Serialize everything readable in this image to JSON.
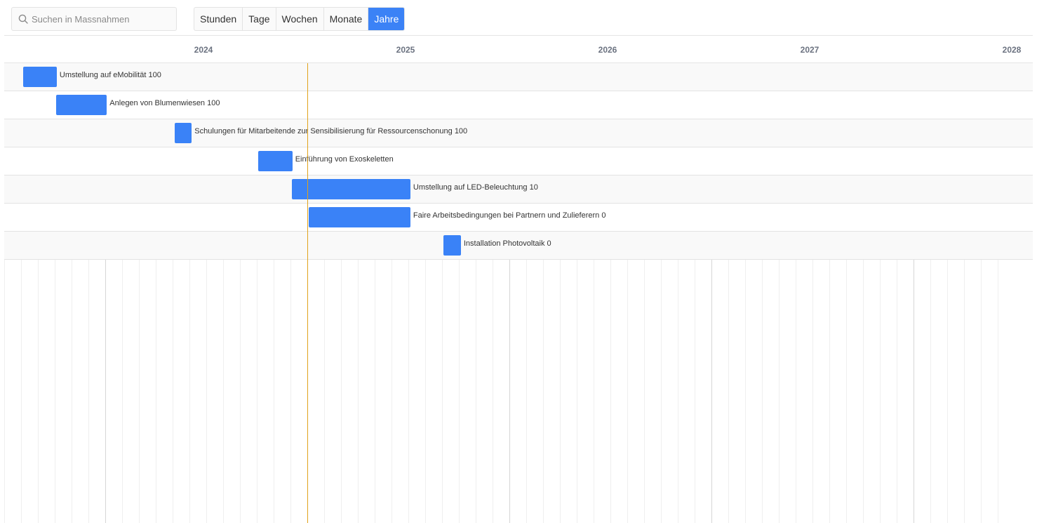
{
  "search": {
    "placeholder": "Suchen in Massnahmen",
    "value": ""
  },
  "view_modes": [
    {
      "label": "Stunden",
      "active": false
    },
    {
      "label": "Tage",
      "active": false
    },
    {
      "label": "Wochen",
      "active": false
    },
    {
      "label": "Monate",
      "active": false
    },
    {
      "label": "Jahre",
      "active": true
    }
  ],
  "timeline": {
    "years": [
      "2024",
      "2025",
      "2026",
      "2027",
      "2028"
    ],
    "start": "2023.5",
    "today": "2025.0"
  },
  "tasks": [
    {
      "name": "Umstellung auf eMobilität",
      "progress": "100",
      "start": 2023.595,
      "end": 2023.76
    },
    {
      "name": "Anlegen von Blumenwiesen",
      "progress": "100",
      "start": 2023.757,
      "end": 2024.008
    },
    {
      "name": "Schulungen für Mitarbeitende zur Sensibilisierung für Ressourcenschonung",
      "progress": "100",
      "start": 2024.343,
      "end": 2024.428
    },
    {
      "name": "Einführung von Exoskeletten",
      "progress": "",
      "start": 2024.756,
      "end": 2024.926
    },
    {
      "name": "Umstellung auf LED-Beleuchtung",
      "progress": "10",
      "start": 2024.923,
      "end": 2025.51
    },
    {
      "name": "Faire Arbeitsbedingungen bei Partnern und Zulieferern",
      "progress": "0",
      "start": 2025.007,
      "end": 2025.51
    },
    {
      "name": "Installation Photovoltaik",
      "progress": "0",
      "start": 2025.674,
      "end": 2025.76
    }
  ],
  "colors": {
    "bar": "#3a82f7",
    "today_line": "#e0a31b",
    "active_view": "#3b82f6"
  }
}
